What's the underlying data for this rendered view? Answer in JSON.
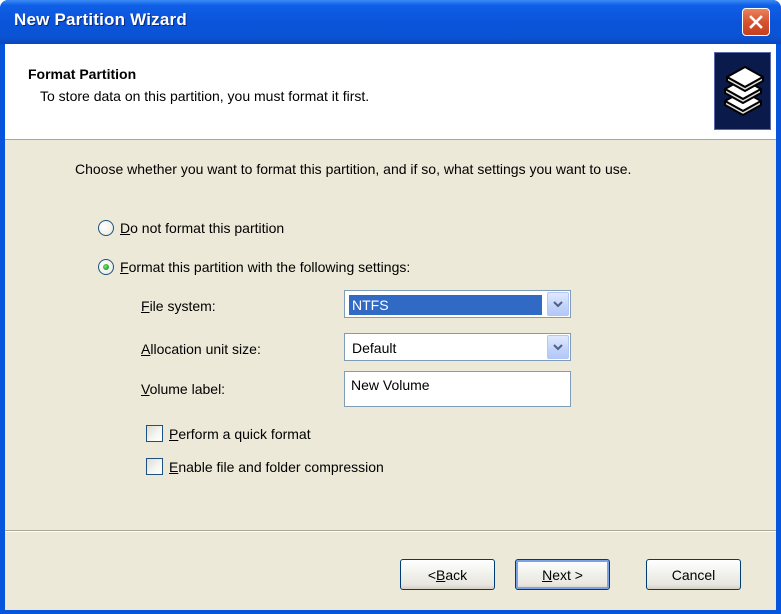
{
  "window": {
    "title": "New Partition Wizard"
  },
  "header": {
    "title": "Format Partition",
    "subtitle": "To store data on this partition, you must format it first.",
    "icon": "stacked-disks-icon"
  },
  "intro": "Choose whether you want to format this partition, and if so, what settings you want to use.",
  "options": {
    "no_format": {
      "hotkey": "D",
      "rest": "o not format this partition",
      "checked": false
    },
    "format": {
      "hotkey": "F",
      "rest": "ormat this partition with the following settings:",
      "checked": true
    }
  },
  "fields": {
    "file_system": {
      "hotkey": "F",
      "rest": "ile system:",
      "value": "NTFS"
    },
    "alloc_unit": {
      "hotkey": "A",
      "rest": "llocation unit size:",
      "value": "Default"
    },
    "volume_label": {
      "hotkey": "V",
      "rest": "olume label:",
      "value": "New Volume"
    }
  },
  "checkboxes": {
    "quick_format": {
      "hotkey": "P",
      "rest": "erform a quick format",
      "checked": false
    },
    "compression": {
      "hotkey": "E",
      "rest": "nable file and folder compression",
      "checked": false
    }
  },
  "buttons": {
    "back": {
      "prefix": "< ",
      "hotkey": "B",
      "rest": "ack"
    },
    "next": {
      "hotkey": "N",
      "rest": "ext >"
    },
    "cancel": "Cancel"
  },
  "colors": {
    "titlebar": "#0a54db",
    "dialog_bg": "#ece9d8",
    "selection": "#316ac5",
    "close_button": "#d7532f"
  }
}
